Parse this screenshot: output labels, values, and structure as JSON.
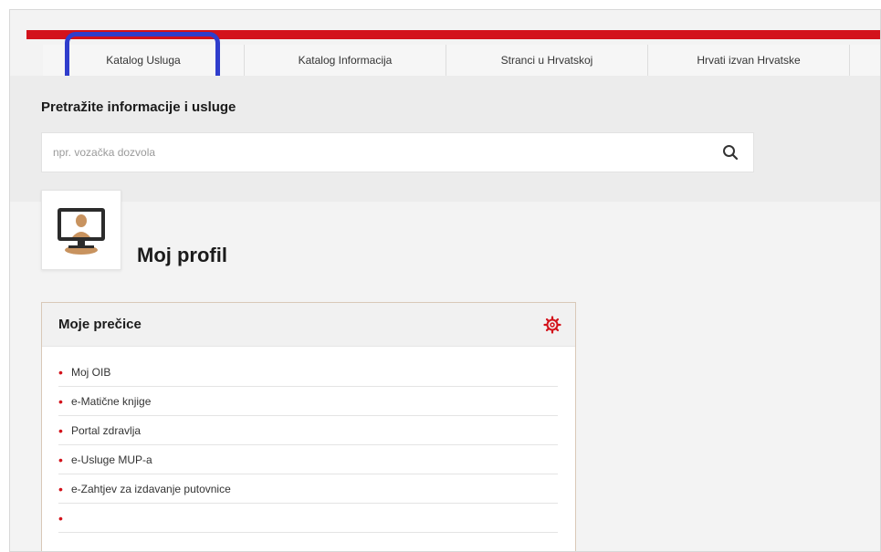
{
  "tabs": [
    {
      "label": "Katalog Usluga"
    },
    {
      "label": "Katalog Informacija"
    },
    {
      "label": "Stranci u Hrvatskoj"
    },
    {
      "label": "Hrvati izvan Hrvatske"
    }
  ],
  "search": {
    "title": "Pretražite informacije i usluge",
    "placeholder": "npr. vozačka dozvola",
    "icon": "search-icon"
  },
  "profile": {
    "title": "Moj profil",
    "avatar_icon": "person-at-computer-icon"
  },
  "shortcuts": {
    "title": "Moje prečice",
    "settings_icon": "gear-icon",
    "items": [
      {
        "label": "Moj OIB"
      },
      {
        "label": "e-Matične knjige"
      },
      {
        "label": "Portal zdravlja"
      },
      {
        "label": "e-Usluge MUP-a"
      },
      {
        "label": "e-Zahtjev za izdavanje putovnice"
      },
      {
        "label": ""
      }
    ]
  },
  "colors": {
    "accent_red": "#d3121b",
    "highlight_blue": "#2f3dcc"
  }
}
